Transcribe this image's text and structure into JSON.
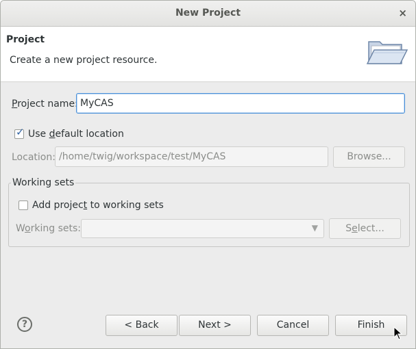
{
  "window": {
    "title": "New Project",
    "close_glyph": "×"
  },
  "banner": {
    "title": "Project",
    "description": "Create a new project resource.",
    "icon": "folder-icon"
  },
  "project_name": {
    "label_prefix": "",
    "label_mnemonic": "P",
    "label_rest": "roject name:",
    "value": "MyCAS"
  },
  "default_location": {
    "label_pre": "Use ",
    "label_mnemonic": "d",
    "label_rest": "efault location",
    "checked": true
  },
  "location": {
    "label": "Location:",
    "value": "/home/twig/workspace/test/MyCAS",
    "browse_label": "Browse..."
  },
  "working_sets": {
    "group_title": "Working sets",
    "add_pre": "Add projec",
    "add_mnemonic": "t",
    "add_rest": " to working sets",
    "add_checked": false,
    "field_pre": "W",
    "field_mnemonic": "o",
    "field_rest": "rking sets:",
    "value": "",
    "select_pre": "S",
    "select_mnemonic": "e",
    "select_rest": "lect..."
  },
  "footer": {
    "help_glyph": "?",
    "back": "< Back",
    "next": "Next >",
    "cancel": "Cancel",
    "finish": "Finish"
  }
}
